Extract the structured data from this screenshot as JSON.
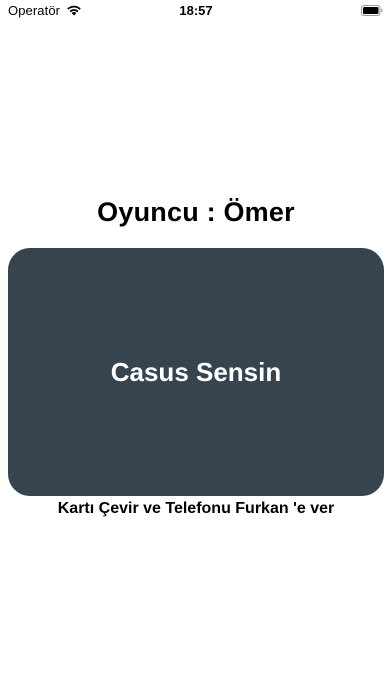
{
  "status_bar": {
    "carrier": "Operatör",
    "time": "18:57",
    "wifi_icon": "wifi-icon",
    "battery_icon": "battery-icon"
  },
  "game": {
    "player_title": "Oyuncu : Ömer",
    "role_card_text": "Casus Sensin",
    "card_color": "#36444f",
    "instruction": "Kartı Çevir ve Telefonu Furkan 'e ver"
  }
}
